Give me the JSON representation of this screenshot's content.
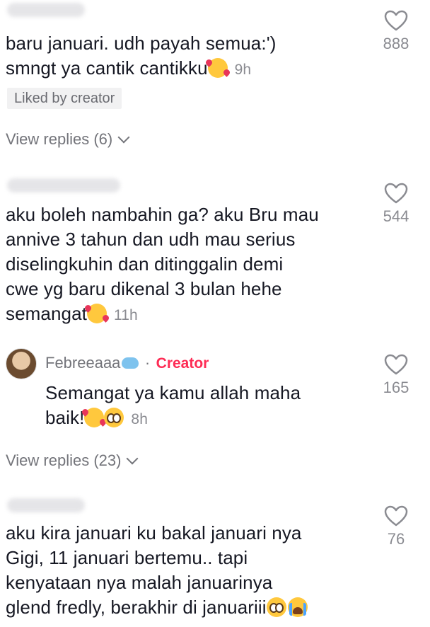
{
  "comments": [
    {
      "lines": [
        "baru januari. udh payah semua:')",
        "smngt ya cantik cantikku"
      ],
      "timestamp": "9h",
      "badge": "Liked by creator",
      "likes": "888",
      "view_replies": "View replies (6)"
    },
    {
      "lines": [
        "aku boleh nambahin ga? aku Bru mau",
        "annive 3 tahun dan udh mau serius",
        "diselingkuhin dan ditinggalin demi",
        "cwe yg baru dikenal 3 bulan hehe",
        "semangat"
      ],
      "timestamp": "11h",
      "likes": "544"
    },
    {
      "author": "Febreeaaa",
      "separator": "·",
      "creator_label": "Creator",
      "lines": [
        "Semangat ya kamu allah maha",
        "baik!"
      ],
      "timestamp": "8h",
      "likes": "165",
      "view_replies": "View replies (23)"
    },
    {
      "lines": [
        "aku kira januari ku bakal januari nya",
        "Gigi, 11 januari bertemu.. tapi",
        "kenyataan nya malah januarinya",
        "glend fredly, berakhir di januariii"
      ],
      "likes": "76"
    }
  ],
  "icons": {
    "like": "heart-outline-icon",
    "expand": "chevron-down-icon",
    "emoji_smiling_hearts": "smiling-face-with-hearts-icon",
    "emoji_pleading": "pleading-face-icon",
    "emoji_crying": "loudly-crying-face-icon",
    "badge_whale": "whale-icon"
  },
  "colors": {
    "creator_accent": "#fe2c55",
    "text_primary": "#161823",
    "text_secondary": "#8a8b91",
    "badge_bg": "#f1f1f2"
  }
}
